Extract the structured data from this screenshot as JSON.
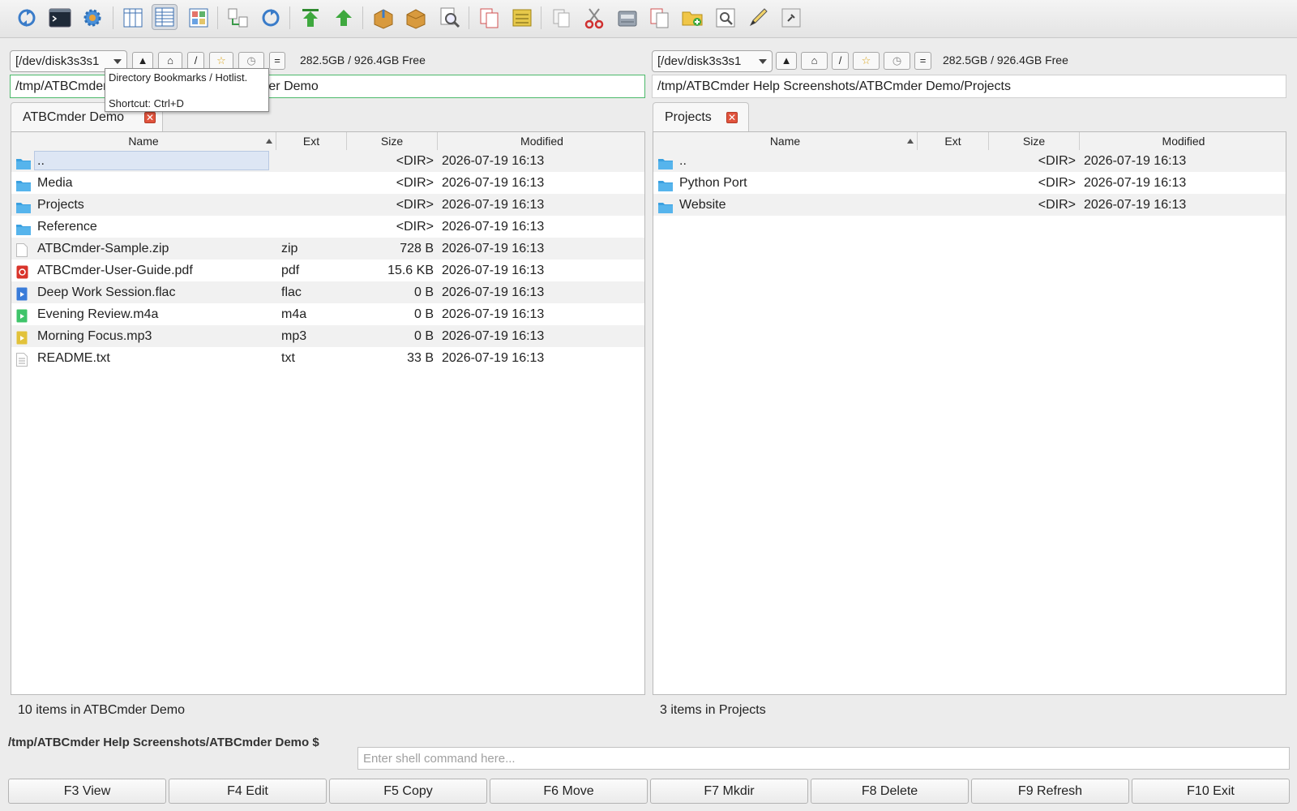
{
  "toolbar": {
    "icons": [
      "refresh-icon",
      "terminal-icon",
      "settings-gear-icon",
      "brief-view-icon",
      "full-view-icon",
      "thumbnail-view-icon",
      "compare-directories-icon",
      "sync-directories-icon",
      "go-to-root-icon",
      "go-up-icon",
      "pack-files-icon",
      "unpack-files-icon",
      "search-files-icon",
      "copy-files-icon",
      "move-files-icon",
      "copy-clipboard-icon",
      "cut-icon",
      "paste-icon",
      "duplicate-icon",
      "new-folder-icon",
      "view-file-icon",
      "edit-file-icon",
      "run-icon"
    ]
  },
  "left": {
    "drive": "[/dev/disk3s3s1",
    "buttons": [
      "▲",
      "⌂",
      "/",
      "☆",
      "◷",
      "="
    ],
    "free": "282.5GB / 926.4GB Free",
    "path": "/tmp/ATBCmder Help Screenshots/ATBCmder Demo",
    "tab": "ATBCmder Demo",
    "columns": {
      "name": "Name",
      "ext": "Ext",
      "size": "Size",
      "modified": "Modified"
    },
    "rows": [
      {
        "name": "..",
        "ext": "",
        "size": "<DIR>",
        "modified": "2026-07-19 16:13",
        "type": "folder"
      },
      {
        "name": "Media",
        "ext": "",
        "size": "<DIR>",
        "modified": "2026-07-19 16:13",
        "type": "folder"
      },
      {
        "name": "Projects",
        "ext": "",
        "size": "<DIR>",
        "modified": "2026-07-19 16:13",
        "type": "folder"
      },
      {
        "name": "Reference",
        "ext": "",
        "size": "<DIR>",
        "modified": "2026-07-19 16:13",
        "type": "folder"
      },
      {
        "name": "ATBCmder-Sample.zip",
        "ext": "zip",
        "size": "728 B",
        "modified": "2026-07-19 16:13",
        "type": "zip"
      },
      {
        "name": "ATBCmder-User-Guide.pdf",
        "ext": "pdf",
        "size": "15.6 KB",
        "modified": "2026-07-19 16:13",
        "type": "pdf"
      },
      {
        "name": "Deep Work Session.flac",
        "ext": "flac",
        "size": "0 B",
        "modified": "2026-07-19 16:13",
        "type": "flac"
      },
      {
        "name": "Evening Review.m4a",
        "ext": "m4a",
        "size": "0 B",
        "modified": "2026-07-19 16:13",
        "type": "m4a"
      },
      {
        "name": "Morning Focus.mp3",
        "ext": "mp3",
        "size": "0 B",
        "modified": "2026-07-19 16:13",
        "type": "mp3"
      },
      {
        "name": "README.txt",
        "ext": "txt",
        "size": "33 B",
        "modified": "2026-07-19 16:13",
        "type": "txt"
      }
    ],
    "status": "10 items in ATBCmder Demo"
  },
  "right": {
    "drive": "[/dev/disk3s3s1",
    "buttons": [
      "▲",
      "⌂",
      "/",
      "☆",
      "◷",
      "="
    ],
    "free": "282.5GB / 926.4GB Free",
    "path": "/tmp/ATBCmder Help Screenshots/ATBCmder Demo/Projects",
    "tab": "Projects",
    "columns": {
      "name": "Name",
      "ext": "Ext",
      "size": "Size",
      "modified": "Modified"
    },
    "rows": [
      {
        "name": "..",
        "ext": "",
        "size": "<DIR>",
        "modified": "2026-07-19 16:13",
        "type": "folder"
      },
      {
        "name": "Python Port",
        "ext": "",
        "size": "<DIR>",
        "modified": "2026-07-19 16:13",
        "type": "folder"
      },
      {
        "name": "Website",
        "ext": "",
        "size": "<DIR>",
        "modified": "2026-07-19 16:13",
        "type": "folder"
      }
    ],
    "status": "3 items in Projects"
  },
  "tooltip": {
    "title": "Directory Bookmarks / Hotlist.",
    "shortcut": "Shortcut: Ctrl+D"
  },
  "shell": {
    "prompt": "/tmp/ATBCmder Help Screenshots/ATBCmder Demo $",
    "placeholder": "Enter shell command here..."
  },
  "fkeys": [
    "F3 View",
    "F4 Edit",
    "F5 Copy",
    "F6 Move",
    "F7 Mkdir",
    "F8 Delete",
    "F9 Refresh",
    "F10 Exit"
  ],
  "colors": {
    "accent": "#4cb96a",
    "folder": "#3aa0e0",
    "selection": "#dde6f4",
    "close": "#e0533d"
  }
}
